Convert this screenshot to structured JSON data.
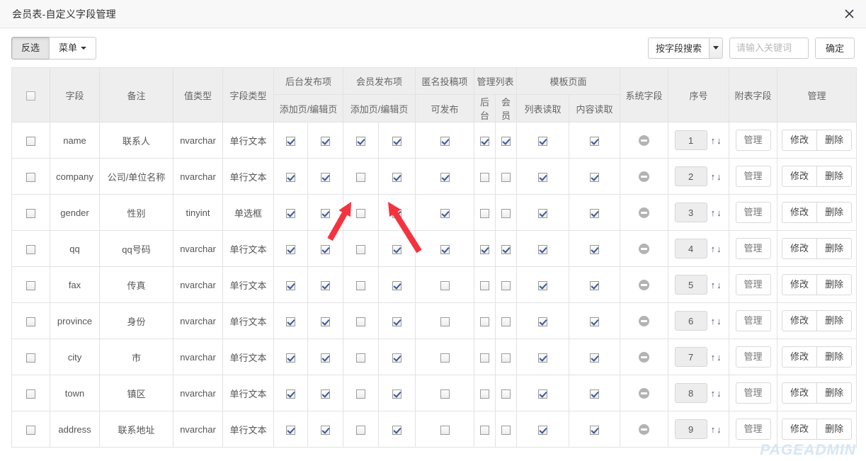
{
  "window": {
    "title": "会员表-自定义字段管理",
    "close_icon": "close-icon"
  },
  "toolbar": {
    "invert_label": "反选",
    "menu_label": "菜单",
    "search_select_label": "按字段搜索",
    "search_placeholder": "请输入关键词",
    "search_value": "",
    "confirm_label": "确定"
  },
  "table": {
    "header_top": [
      "",
      "字段",
      "备注",
      "值类型",
      "字段类型",
      "后台发布项",
      "会员发布项",
      "匿名投稿项",
      "管理列表",
      "模板页面",
      "系统字段",
      "序号",
      "附表字段",
      "管理"
    ],
    "header_sub": {
      "backend_publish": "添加页/编辑页",
      "member_publish": "添加页/编辑页",
      "anonymous_publish": "可发布",
      "list_backend": "后台",
      "list_member": "会员",
      "tpl_list_read": "列表读取",
      "tpl_content_read": "内容读取"
    },
    "row_actions": {
      "manage_label": "管理",
      "edit_label": "修改",
      "delete_label": "删除",
      "up_arrow": "↑",
      "down_arrow": "↓"
    },
    "rows": [
      {
        "field": "name",
        "remark": "联系人",
        "value_type": "nvarchar",
        "field_type": "单行文本",
        "checks": [
          true,
          true,
          true,
          true,
          true,
          true,
          true,
          true,
          true
        ],
        "system_field": false,
        "order": "1"
      },
      {
        "field": "company",
        "remark": "公司/单位名称",
        "value_type": "nvarchar",
        "field_type": "单行文本",
        "checks": [
          true,
          true,
          false,
          true,
          true,
          false,
          false,
          true,
          true
        ],
        "system_field": false,
        "order": "2"
      },
      {
        "field": "gender",
        "remark": "性别",
        "value_type": "tinyint",
        "field_type": "单选框",
        "checks": [
          true,
          true,
          false,
          true,
          true,
          false,
          false,
          true,
          true
        ],
        "system_field": false,
        "order": "3"
      },
      {
        "field": "qq",
        "remark": "qq号码",
        "value_type": "nvarchar",
        "field_type": "单行文本",
        "checks": [
          true,
          true,
          false,
          true,
          true,
          true,
          true,
          true,
          true
        ],
        "system_field": false,
        "order": "4"
      },
      {
        "field": "fax",
        "remark": "传真",
        "value_type": "nvarchar",
        "field_type": "单行文本",
        "checks": [
          true,
          true,
          false,
          true,
          false,
          false,
          false,
          true,
          true
        ],
        "system_field": false,
        "order": "5"
      },
      {
        "field": "province",
        "remark": "身份",
        "value_type": "nvarchar",
        "field_type": "单行文本",
        "checks": [
          true,
          true,
          false,
          true,
          false,
          false,
          false,
          true,
          true
        ],
        "system_field": false,
        "order": "6"
      },
      {
        "field": "city",
        "remark": "市",
        "value_type": "nvarchar",
        "field_type": "单行文本",
        "checks": [
          true,
          true,
          false,
          true,
          false,
          false,
          false,
          true,
          true
        ],
        "system_field": false,
        "order": "7"
      },
      {
        "field": "town",
        "remark": "镇区",
        "value_type": "nvarchar",
        "field_type": "单行文本",
        "checks": [
          true,
          true,
          false,
          true,
          false,
          false,
          false,
          true,
          true
        ],
        "system_field": false,
        "order": "8"
      },
      {
        "field": "address",
        "remark": "联系地址",
        "value_type": "nvarchar",
        "field_type": "单行文本",
        "checks": [
          true,
          true,
          false,
          true,
          false,
          false,
          false,
          true,
          true
        ],
        "system_field": false,
        "order": "9"
      }
    ]
  },
  "watermark": "PAGEADMIN",
  "annotations": {
    "arrow_color": "#f5333f",
    "arrows": [
      {
        "points_to": "row1-member-publish-add-checkbox"
      },
      {
        "points_to": "row1-member-publish-edit-checkbox"
      }
    ]
  }
}
